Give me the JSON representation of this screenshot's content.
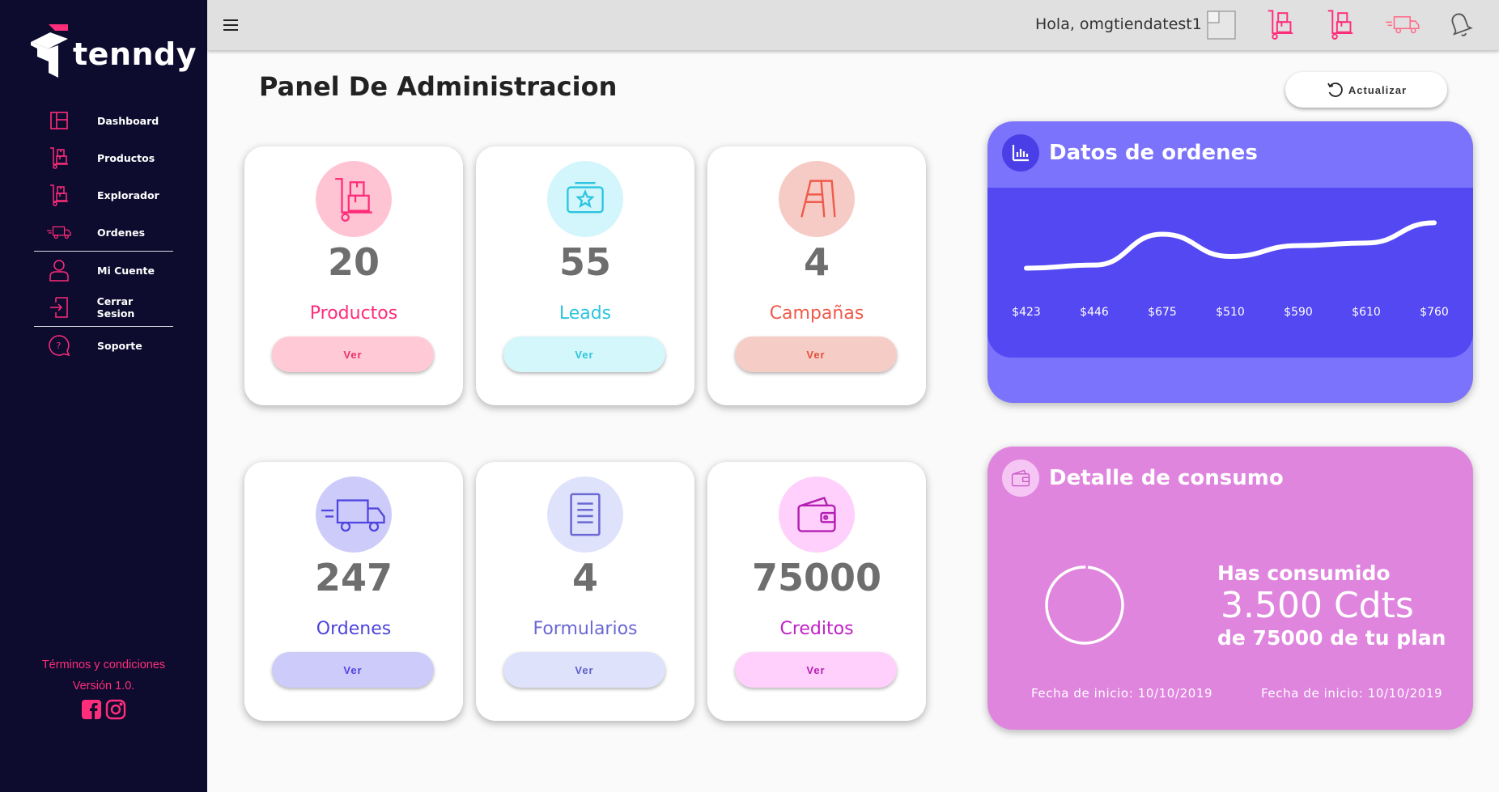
{
  "brand": {
    "name": "tenndy"
  },
  "sidebar": {
    "items": [
      {
        "label": "Dashboard",
        "icon": "dashboard-icon"
      },
      {
        "label": "Productos",
        "icon": "product-cart-icon"
      },
      {
        "label": "Explorador",
        "icon": "product-cart-icon"
      },
      {
        "label": "Ordenes",
        "icon": "truck-icon"
      },
      {
        "label": "Mi Cuente",
        "icon": "user-icon"
      },
      {
        "label": "Cerrar Sesion",
        "icon": "logout-icon"
      },
      {
        "label": "Soporte",
        "icon": "help-chat-icon"
      }
    ],
    "footer": {
      "terms": "Términos y condiciones",
      "version": "Versión 1.0."
    }
  },
  "topbar": {
    "greeting": "Hola, omgtiendatest1"
  },
  "main": {
    "title": "Panel De Administracion",
    "refresh_label": "Actualizar"
  },
  "cards": [
    {
      "value": "20",
      "label": "Productos",
      "button": "Ver",
      "label_color": "#ff2d7a",
      "circle_color": "#ffc4d4",
      "button_bg": "#ffc9d6",
      "button_color": "#e8326e"
    },
    {
      "value": "55",
      "label": "Leads",
      "button": "Ver",
      "label_color": "#2cc5e0",
      "circle_color": "#d2f6fb",
      "button_bg": "#d4f7fb",
      "button_color": "#2cc5e0"
    },
    {
      "value": "4",
      "label": "Campañas",
      "button": "Ver",
      "label_color": "#f05a4a",
      "circle_color": "#f6cbc6",
      "button_bg": "#f6cdc6",
      "button_color": "#e0503e"
    },
    {
      "value": "247",
      "label": "Ordenes",
      "button": "Ver",
      "label_color": "#4e44de",
      "circle_color": "#cdcbf9",
      "button_bg": "#cdcbfa",
      "button_color": "#4e44de"
    },
    {
      "value": "4",
      "label": "Formularios",
      "button": "Ver",
      "label_color": "#6a68d4",
      "circle_color": "#dfe2fb",
      "button_bg": "#dee2fb",
      "button_color": "#5f5ec8"
    },
    {
      "value": "75000",
      "label": "Creditos",
      "button": "Ver",
      "label_color": "#c21fc7",
      "circle_color": "#fed0fb",
      "button_bg": "#fed0fb",
      "button_color": "#b41fb4"
    }
  ],
  "orders_panel": {
    "title": "Datos de ordenes"
  },
  "chart_data": {
    "type": "line",
    "title": "Datos de ordenes",
    "categories": [
      "$423",
      "$446",
      "$675",
      "$510",
      "$590",
      "$610",
      "$760"
    ],
    "series": [
      {
        "values": [
          423,
          446,
          675,
          510,
          590,
          610,
          760
        ]
      }
    ],
    "ylim": [
      300,
      900
    ],
    "grid": false
  },
  "consumo_panel": {
    "title": "Detalle de consumo",
    "line1": "Has consumido",
    "line2": "3.500 Cdts",
    "line3": "de 75000 de tu plan",
    "fecha_left": "Fecha de inicio: 10/10/2019",
    "fecha_right": "Fecha de inicio: 10/10/2019"
  }
}
